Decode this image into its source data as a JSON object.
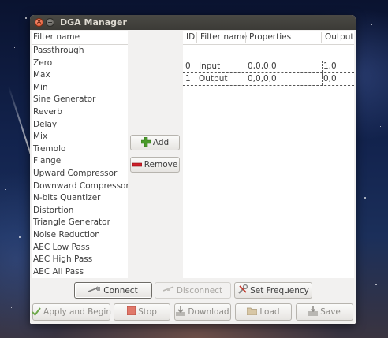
{
  "window": {
    "title": "DGA Manager"
  },
  "filter_list": {
    "header": "Filter name",
    "items": [
      "Passthrough",
      "Zero",
      "Max",
      "Min",
      "Sine Generator",
      "Reverb",
      "Delay",
      "Mix",
      "Tremolo",
      "Flange",
      "Upward Compressor",
      "Downward Compressor",
      "N-bits Quantizer",
      "Distortion",
      "Triangle Generator",
      "Noise Reduction",
      "AEC Low Pass",
      "AEC High Pass",
      "AEC All Pass"
    ]
  },
  "middle": {
    "add_label": "Add",
    "remove_label": "Remove"
  },
  "graph_table": {
    "columns": [
      "ID",
      "Filter name",
      "Properties",
      "Output"
    ],
    "rows": [
      {
        "id": "0",
        "name": "Input",
        "properties": "0,0,0,0",
        "output": "1,0"
      },
      {
        "id": "1",
        "name": "Output",
        "properties": "0,0,0,0",
        "output": "0,0"
      }
    ]
  },
  "actions_row1": {
    "connect": "Connect",
    "disconnect": "Disconnect",
    "set_frequency": "Set Frequency"
  },
  "actions_row2": {
    "apply_and_begin": "Apply and Begin",
    "stop": "Stop",
    "download": "Download",
    "load": "Load",
    "save": "Save"
  },
  "icons": {
    "add": "plus-icon",
    "remove": "minus-icon",
    "connect": "plug-icon",
    "disconnect": "unplug-icon",
    "set_frequency": "tools-icon",
    "apply": "check-icon",
    "stop": "stop-icon",
    "download": "download-icon",
    "load": "folder-icon",
    "save": "save-icon"
  },
  "colors": {
    "add_icon": "#4a9a2a",
    "remove_icon": "#d0202a",
    "stop_icon": "#e0786a",
    "titlebar": "#3c3b37"
  }
}
